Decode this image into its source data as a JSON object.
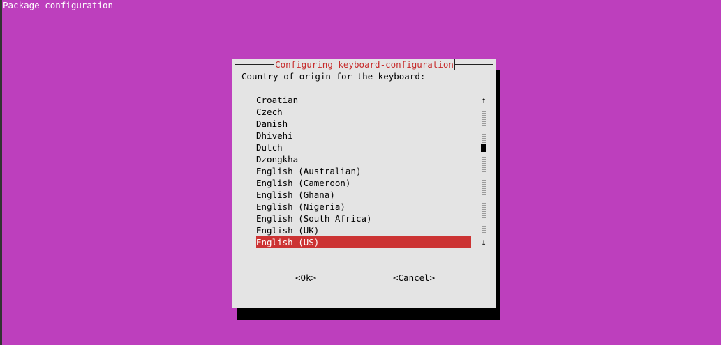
{
  "header": {
    "title": "Package configuration"
  },
  "dialog": {
    "title": "Configuring keyboard-configuration",
    "prompt": "Country of origin for the keyboard:",
    "items": [
      {
        "label": "Croatian"
      },
      {
        "label": "Czech"
      },
      {
        "label": "Danish"
      },
      {
        "label": "Dhivehi"
      },
      {
        "label": "Dutch"
      },
      {
        "label": "Dzongkha"
      },
      {
        "label": "English (Australian)"
      },
      {
        "label": "English (Cameroon)"
      },
      {
        "label": "English (Ghana)"
      },
      {
        "label": "English (Nigeria)"
      },
      {
        "label": "English (South Africa)"
      },
      {
        "label": "English (UK)"
      },
      {
        "label": "English (US)"
      }
    ],
    "selected_item": "English (US)",
    "scrollbar": {
      "up_arrow": "↑",
      "down_arrow": "↓"
    },
    "buttons": {
      "ok": "<Ok>",
      "cancel": "<Cancel>"
    }
  },
  "colors": {
    "background": "#bd3fbd",
    "dialog": "#e4e4e4",
    "title": "#c62a2a",
    "selection": "#cc3333"
  }
}
